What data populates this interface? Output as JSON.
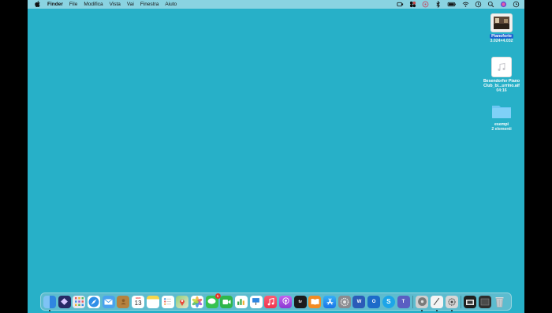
{
  "menubar": {
    "app_name": "Finder",
    "items": [
      "File",
      "Modifica",
      "Vista",
      "Vai",
      "Finestra",
      "Aiuto"
    ]
  },
  "status_icons": [
    "screen-record-icon",
    "control-center-icon",
    "focus-icon",
    "bluetooth-icon",
    "battery-icon",
    "wifi-icon",
    "time-machine-icon",
    "spotlight-search-icon",
    "siri-icon",
    "clock-icon"
  ],
  "desktop": {
    "items": [
      {
        "name": "Pianoforte",
        "sub": "3.024×4.032",
        "kind": "image",
        "selected": true
      },
      {
        "name": "Besendorfer Piano Club_bi...urrino.aif",
        "sub": "04:16",
        "kind": "audio",
        "selected": false
      },
      {
        "name": "esempi",
        "sub": "2 elementi",
        "kind": "folder",
        "selected": false
      }
    ]
  },
  "dock": {
    "calendar_month": "GEN",
    "calendar_day": "13",
    "messages_badge": "1",
    "apps": [
      {
        "name": "finder",
        "color": "#3a8ee6"
      },
      {
        "name": "siri",
        "color": "#2b2d6e"
      },
      {
        "name": "launchpad",
        "color": "#e9e9ee"
      },
      {
        "name": "safari",
        "color": "#3c8ce7"
      },
      {
        "name": "mail",
        "color": "#4aa2ee"
      },
      {
        "name": "notes-brown",
        "color": "#b07a3c"
      },
      {
        "name": "calendar",
        "color": "#ffffff"
      },
      {
        "name": "notes",
        "color": "#f6e27a"
      },
      {
        "name": "reminders",
        "color": "#ffffff"
      },
      {
        "name": "maps",
        "color": "#6fc26a"
      },
      {
        "name": "photos",
        "color": "#f0f0f0"
      },
      {
        "name": "messages",
        "color": "#36c24f"
      },
      {
        "name": "facetime",
        "color": "#2fb64a"
      },
      {
        "name": "numbers",
        "color": "#3aa84a"
      },
      {
        "name": "keynote-like",
        "color": "#ffffff"
      },
      {
        "name": "music",
        "color": "#f04a5d"
      },
      {
        "name": "podcasts",
        "color": "#9b4fd6"
      },
      {
        "name": "apple-tv",
        "color": "#1b1b1b"
      },
      {
        "name": "books",
        "color": "#f28b23"
      },
      {
        "name": "app-store",
        "color": "#1f8ff0"
      },
      {
        "name": "system-preferences",
        "color": "#7d7d82"
      },
      {
        "name": "word",
        "color": "#2b5bb8"
      },
      {
        "name": "outlook",
        "color": "#1d6bc9"
      },
      {
        "name": "skype",
        "color": "#1da5e8"
      },
      {
        "name": "teams",
        "color": "#5a5ec2"
      }
    ],
    "apps2": [
      {
        "name": "disk-utility",
        "color": "#7a7a7a"
      },
      {
        "name": "textedit",
        "color": "#f4f4f4"
      },
      {
        "name": "system-information",
        "color": "#d6d6d6"
      }
    ],
    "apps3": [
      {
        "name": "downloads",
        "color": "#2b2b2b"
      },
      {
        "name": "screenshot-stack",
        "color": "#3a3a3a"
      },
      {
        "name": "trash",
        "color": "#b9c1c6"
      }
    ]
  }
}
